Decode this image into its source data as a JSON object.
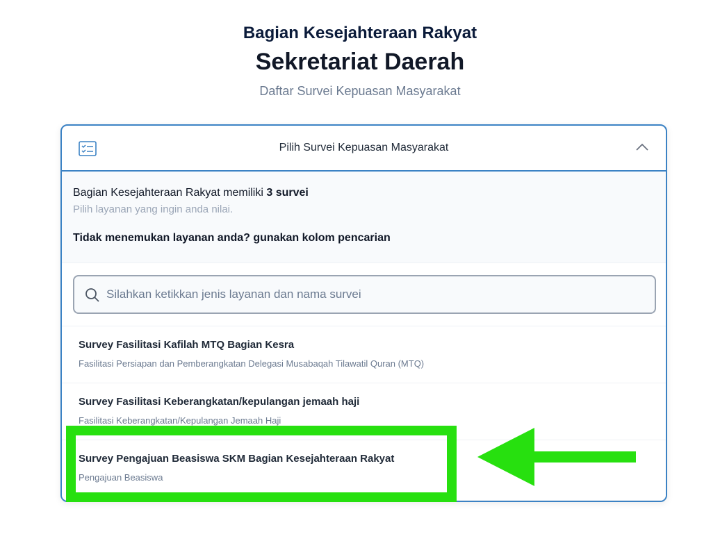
{
  "header": {
    "subtitle": "Bagian Kesejahteraan Rakyat",
    "title": "Sekretariat Daerah",
    "description": "Daftar Survei Kepuasan Masyarakat"
  },
  "panel": {
    "title": "Pilih Survei Kepuasan Masyarakat",
    "info_prefix": "Bagian Kesejahteraan Rakyat memiliki ",
    "info_count": "3 survei",
    "info_hint": "Pilih layanan yang ingin anda nilai.",
    "info_search_hint": "Tidak menemukan layanan anda? gunakan kolom pencarian"
  },
  "search": {
    "placeholder": "Silahkan ketikkan jenis layanan dan nama survei",
    "value": ""
  },
  "surveys": [
    {
      "title": "Survey Fasilitasi Kafilah MTQ Bagian Kesra",
      "description": "Fasilitasi Persiapan dan Pemberangkatan Delegasi Musabaqah Tilawatil Quran (MTQ)"
    },
    {
      "title": "Survey Fasilitasi Keberangkatan/kepulangan jemaah haji",
      "description": "Fasilitasi Keberangkatan/Kepulangan Jemaah Haji"
    },
    {
      "title": "Survey Pengajuan Beasiswa SKM Bagian Kesejahteraan Rakyat",
      "description": "Pengajuan Beasiswa"
    }
  ],
  "icons": {
    "panel_icon": "list-check-icon",
    "collapse_icon": "chevron-up-icon",
    "search_icon": "search-icon"
  },
  "colors": {
    "accent_border": "#3b82c4",
    "annotation": "#27e00f"
  }
}
